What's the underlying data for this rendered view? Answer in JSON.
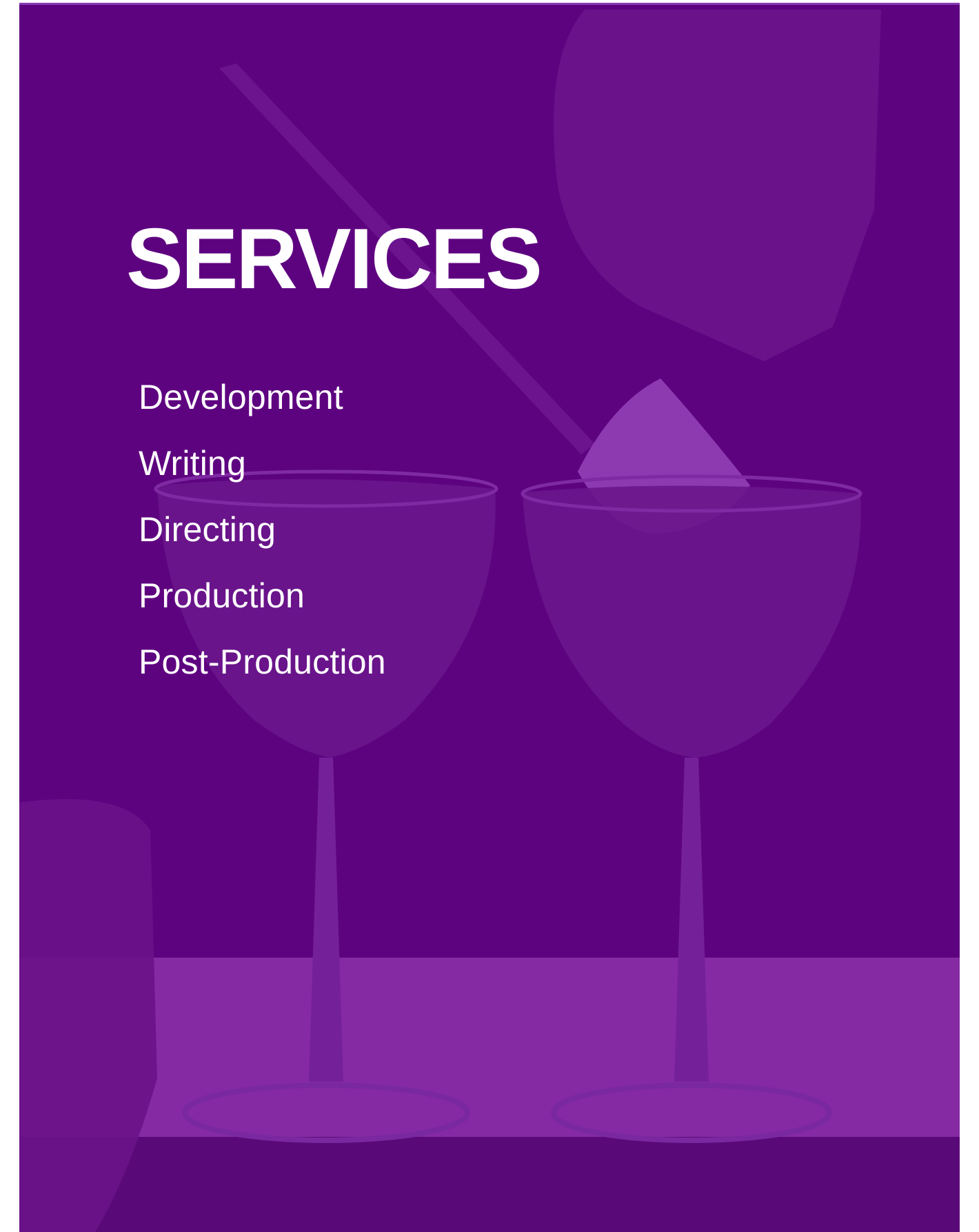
{
  "section": {
    "title": "SERVICES",
    "items": [
      "Development",
      "Writing",
      "Directing",
      "Production",
      "Post-Production"
    ]
  },
  "background": {
    "image": "purple-tinted-cocktail-glasses-photo",
    "tint_color": "#5e0380"
  }
}
